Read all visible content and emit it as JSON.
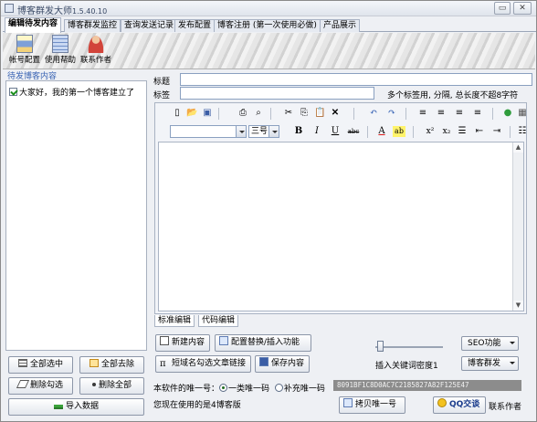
{
  "window": {
    "title": "博客群发大师",
    "version": "1.5.40.10",
    "minimize_glyph": "▭",
    "close_glyph": "✕"
  },
  "tabs": [
    {
      "label": "编辑待发内容",
      "active": true
    },
    {
      "label": "博客群发监控"
    },
    {
      "label": "查询发送记录"
    },
    {
      "label": "发布配置"
    },
    {
      "label": "博客注册 (第一次使用必做)"
    },
    {
      "label": "产品展示"
    }
  ],
  "banner": {
    "tools": [
      {
        "label": "帐号配置",
        "icon": "account-config-icon"
      },
      {
        "label": "使用帮助",
        "icon": "help-book-icon"
      },
      {
        "label": "联系作者",
        "icon": "person-icon"
      }
    ]
  },
  "left": {
    "section_label": "待发博客内容",
    "posts": [
      {
        "title": "大家好，我的第一个博客建立了",
        "checked": true
      }
    ],
    "buttons": {
      "select_all": "全部选中",
      "deselect_all": "全部去除",
      "delete_checked": "删除勾选",
      "delete_all": "删除全部",
      "import": "导入数据"
    }
  },
  "form": {
    "title_label": "标题",
    "title_value": "",
    "tags_label": "标签",
    "tags_value": "",
    "tags_hint": "多个标签用, 分隔, 总长度不超8字符"
  },
  "editor": {
    "font_size": "三号",
    "tabs": [
      "标准编辑",
      "代码编辑"
    ],
    "toolbar_row1": [
      "▯",
      "📂",
      "▣",
      "⎙",
      "⌕",
      "✂",
      "⎘",
      "📋",
      "✕",
      "↶",
      "↷",
      "≡",
      "≡",
      "≡",
      "≡",
      "●",
      "▦"
    ],
    "toolbar_row2": [
      "B",
      "I",
      "U",
      "abc",
      "A",
      "ab",
      "x²",
      "x₂",
      "☰",
      "⇤",
      "⇥",
      "☷"
    ]
  },
  "actions": {
    "new_content": "新建内容",
    "config_replace": "配置替换/插入功能",
    "short_link": "短域名勾选文章链接",
    "save_content": "保存内容",
    "seo": "SEO功能",
    "keyword_density": "插入关键词密度1",
    "blog_send": "博客群发",
    "copy_code": "拷贝唯一号",
    "qq": "QQ交谈",
    "contact": "联系作者"
  },
  "unique": {
    "label": "本软件的唯一号：",
    "option1": "一类唯一码",
    "option2": "补充唯一码",
    "code": "8091BF1C8D0AC7C2185827A82F125E47",
    "version_note": "您现在使用的是4博客版"
  },
  "colors": {
    "accent_blue": "#3a64b4",
    "code_bg": "#8c8c8c",
    "qq_yellow": "#f3c21f"
  }
}
